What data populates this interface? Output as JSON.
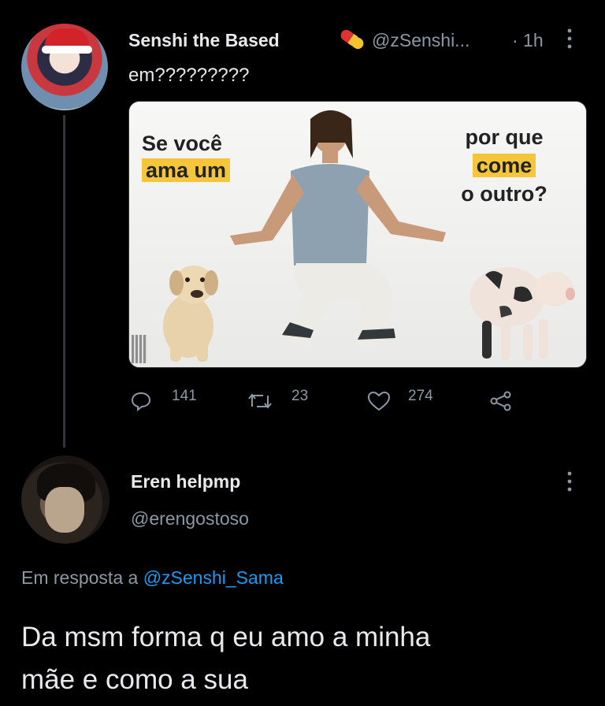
{
  "tweet": {
    "author_name": "Senshi the Based",
    "handle": "@zSenshi...",
    "time": "· 1h",
    "text": "em?????????",
    "media": {
      "caption_left_line1": "Se você",
      "caption_left_line2": "ama um",
      "caption_right_line1": "por que",
      "caption_right_line2": "come",
      "caption_right_line3": "o outro?"
    },
    "stats": {
      "replies": "141",
      "retweets": "23",
      "likes": "274"
    }
  },
  "reply": {
    "author_name": "Eren helpmp",
    "handle": "@erengostoso",
    "replying_prefix": "Em resposta a",
    "replying_to": "@zSenshi_Sama",
    "text_line1": "Da msm forma q eu amo a minha",
    "text_line2": "mãe e como a sua"
  },
  "colors": {
    "background": "#000000",
    "text": "#e7e9ea",
    "muted": "#8b98a5",
    "link": "#1d9bf0",
    "highlight": "#f5c63a"
  },
  "icons": [
    "more-icon",
    "pill-icon",
    "reply-icon",
    "retweet-icon",
    "like-icon",
    "share-icon"
  ]
}
